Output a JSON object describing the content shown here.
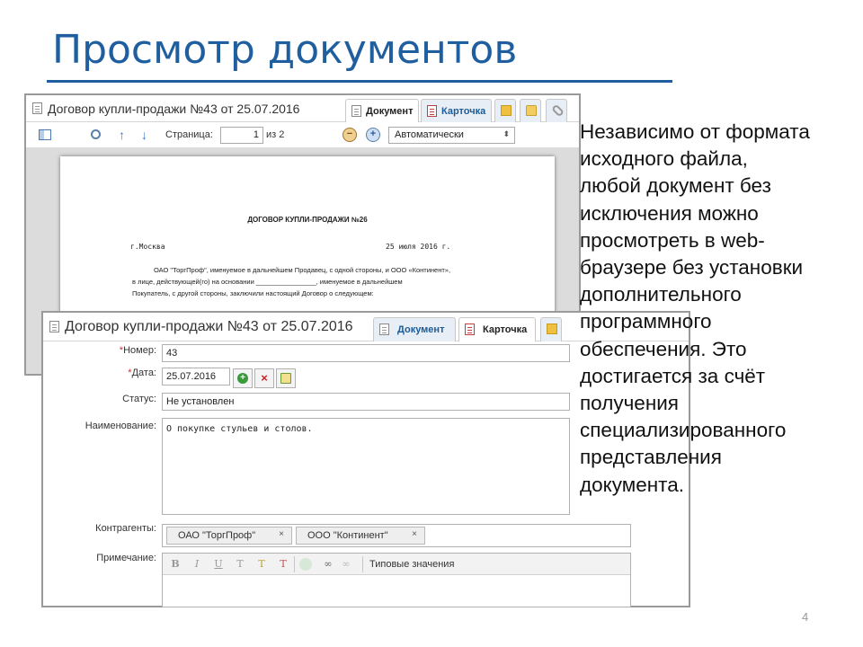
{
  "slide": {
    "title": "Просмотр документов",
    "page_number": "4",
    "side_text_lines": [
      "Независимо от формата",
      "исходного файла,",
      "любой документ без",
      "исключения можно",
      "просмотреть в web-",
      "браузере без установки",
      "дополнительного",
      "программного",
      "обеспечения. Это",
      "достигается за счёт",
      "получения",
      "специализированного",
      "представления",
      "документа."
    ]
  },
  "viewer_window": {
    "title": "Договор купли-продажи №43 от 25.07.2016",
    "tabs": {
      "document": "Документ",
      "card": "Карточка"
    },
    "toolbar": {
      "page_label": "Страница:",
      "page_value": "1",
      "page_total": "из 2",
      "zoom_mode": "Автоматически"
    },
    "document": {
      "heading": "ДОГОВОР КУПЛИ-ПРОДАЖИ №26",
      "city": "г.Москва",
      "date": "25 июля 2016 г.",
      "body_lines": [
        "ОАО \"ТоргПроф\", именуемое в дальнейшем Продавец, с одной стороны, и ООО «Континент»,",
        "в лице, действующей(го) на основании ________________, именуемое в дальнейшем",
        "Покупатель, с другой стороны, заключили настоящий Договор о следующем:"
      ]
    }
  },
  "card_window": {
    "title": "Договор купли-продажи №43 от 25.07.2016",
    "tabs": {
      "document": "Документ",
      "card": "Карточка"
    },
    "fields": {
      "number_label": "Номер:",
      "number_value": "43",
      "date_label": "Дата:",
      "date_value": "25.07.2016",
      "status_label": "Статус:",
      "status_value": "Не установлен",
      "name_label": "Наименование:",
      "name_value": "О покупке стульев и столов.",
      "counterparties_label": "Контрагенты:",
      "counterparties": [
        "ОАО \"ТоргПроф\"",
        "ООО \"Континент\""
      ],
      "note_label": "Примечание:",
      "typical_values": "Типовые значения"
    },
    "required_mark": "*",
    "tag_remove": "×",
    "date_buttons": {
      "add": "+",
      "clear": "×"
    },
    "rte_buttons": {
      "bold": "B",
      "italic": "I",
      "underline": "U",
      "text_color": "T",
      "highlight": "T",
      "clear_format": "T"
    }
  }
}
